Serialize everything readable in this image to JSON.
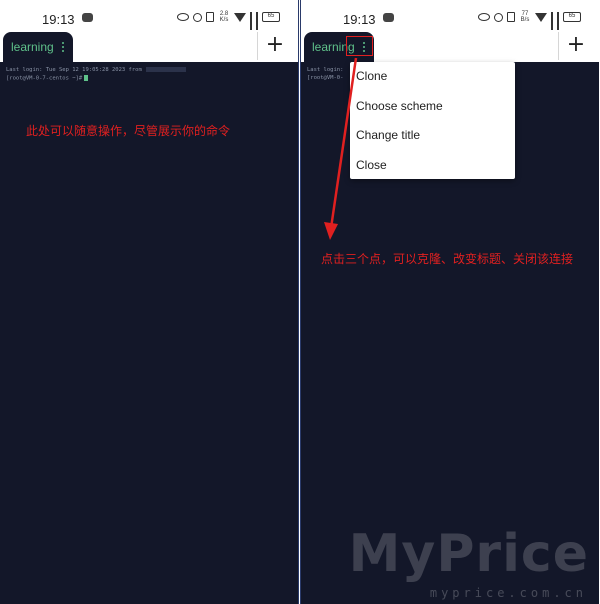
{
  "left_phone": {
    "status": {
      "time": "19:13",
      "speed": "2.8 K/s",
      "battery": "65"
    },
    "tab": {
      "label": "learning"
    },
    "add_label": "+",
    "terminal": {
      "line1": "Last login: Tue Sep 12 19:05:28 2023 from",
      "line2": "[root@VM-0-7-centos ~]#"
    },
    "annotation": "此处可以随意操作，尽管展示你的命令"
  },
  "right_phone": {
    "status": {
      "time": "19:13",
      "speed": "77 B/s",
      "battery": "65"
    },
    "tab": {
      "label": "learning"
    },
    "add_label": "+",
    "terminal": {
      "line1": "Last login:",
      "line2": "[root@VM-0-"
    },
    "menu": {
      "items": [
        "Clone",
        "Choose scheme",
        "Change title",
        "Close"
      ]
    },
    "annotation": "点击三个点，可以克隆、改变标题、关闭该连接"
  },
  "watermark": {
    "main": "MyPrice",
    "sub": "myprice.com.cn"
  },
  "colors": {
    "terminal_bg": "#131729",
    "accent_green": "#5fc18a",
    "annotation_red": "#e02020"
  }
}
